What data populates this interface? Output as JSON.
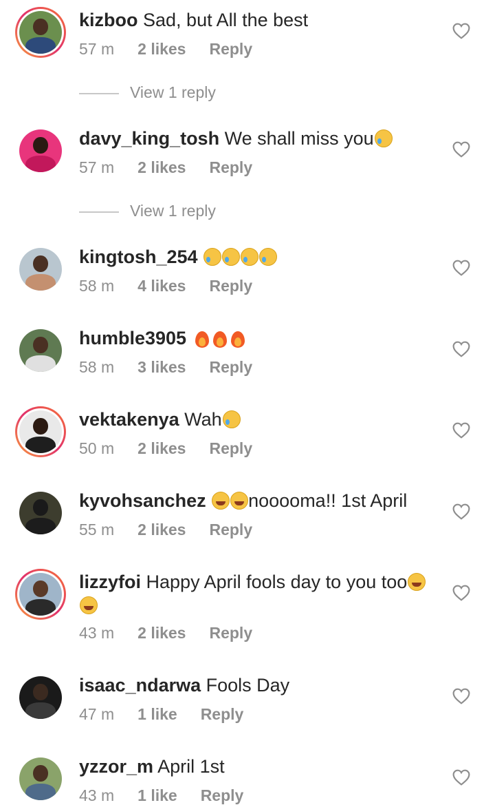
{
  "comments": [
    {
      "username": "kizboo",
      "text": "Sad, but All the best",
      "time": "57 m",
      "likes": "2 likes",
      "reply": "Reply",
      "view_replies": "View 1 reply",
      "has_story": true,
      "avatar_bg": "#6b8f4e",
      "avatar_body": "#2d4a7a"
    },
    {
      "username": "davy_king_tosh",
      "text": "We shall miss you",
      "time": "57 m",
      "likes": "2 likes",
      "reply": "Reply",
      "view_replies": "View 1 reply",
      "has_story": false,
      "avatar_bg": "#e8357c",
      "avatar_body": "#c2185b"
    },
    {
      "username": "kingtosh_254",
      "text": "",
      "time": "58 m",
      "likes": "4 likes",
      "reply": "Reply",
      "has_story": false,
      "avatar_bg": "#b9c6cf",
      "avatar_body": "#c49070"
    },
    {
      "username": "humble3905",
      "text": "",
      "time": "58 m",
      "likes": "3 likes",
      "reply": "Reply",
      "has_story": false,
      "avatar_bg": "#5f7a52",
      "avatar_body": "#e0e0e0"
    },
    {
      "username": "vektakenya",
      "text": "Wah",
      "time": "50 m",
      "likes": "2 likes",
      "reply": "Reply",
      "has_story": true,
      "avatar_bg": "#e9e9e9",
      "avatar_body": "#1e1e1e"
    },
    {
      "username": "kyvohsanchez",
      "text": "nooooma!! 1st April",
      "time": "55 m",
      "likes": "2 likes",
      "reply": "Reply",
      "has_story": false,
      "avatar_bg": "#3d3d2e",
      "avatar_body": "#1c1c1c"
    },
    {
      "username": "lizzyfoi",
      "text": "Happy April fools day to you too",
      "time": "43 m",
      "likes": "2 likes",
      "reply": "Reply",
      "has_story": true,
      "avatar_bg": "#9fb5c9",
      "avatar_body": "#2a2a2a"
    },
    {
      "username": "isaac_ndarwa",
      "text": "Fools Day",
      "time": "47 m",
      "likes": "1 like",
      "reply": "Reply",
      "has_story": false,
      "avatar_bg": "#1a1a1a",
      "avatar_body": "#3a3a3a"
    },
    {
      "username": "yzzor_m",
      "text": "April 1st",
      "time": "43 m",
      "likes": "1 like",
      "reply": "Reply",
      "has_story": false,
      "avatar_bg": "#8aa36a",
      "avatar_body": "#4f6b8a"
    }
  ],
  "icons": {
    "like": "heart-outline-icon",
    "crying": "crying-face-emoji",
    "laughing": "tears-of-joy-emoji",
    "fire": "fire-emoji"
  },
  "colors": {
    "text": "#262626",
    "secondary": "#8e8e8e",
    "story_ring": "#e1306c"
  }
}
